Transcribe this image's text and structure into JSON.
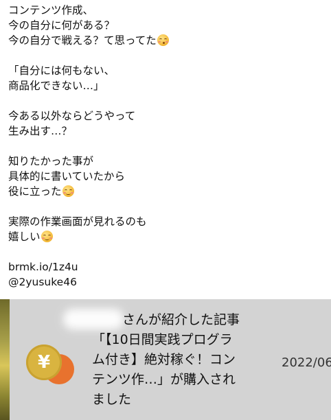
{
  "post": {
    "lines": [
      "コンテンツ作成、",
      "今の自分に何がある？",
      "今の自分で戦える？て思ってた",
      "",
      "「自分には何もない、",
      "商品化できない…」",
      "",
      "今ある以外ならどうやって",
      "生み出す…？",
      "",
      "知りたかった事が",
      "具体的に書いていたから",
      "役に立った",
      "",
      "実際の作業画面が見れるのも",
      "嬉しい",
      "",
      "brmk.io/1z4u",
      "@2yusuke46"
    ],
    "emojis": {
      "line3": "kissing-face-emoji",
      "line13": "relieved-face-emoji",
      "line16": "relieved-face-emoji"
    }
  },
  "notice": {
    "coin_symbol": "¥",
    "coin_icon": "yen-coin-icon",
    "message_lines": [
      "さんが紹介した記事",
      "「【10日間実践プログラ",
      "ム付き】絶対稼ぐ！コン",
      "テンツ作…」が購入され",
      "ました"
    ],
    "date": "2022/06",
    "colors": {
      "background": "#d3d3d3",
      "coin": "#d9b440",
      "coin_accent": "#e8722e"
    }
  }
}
